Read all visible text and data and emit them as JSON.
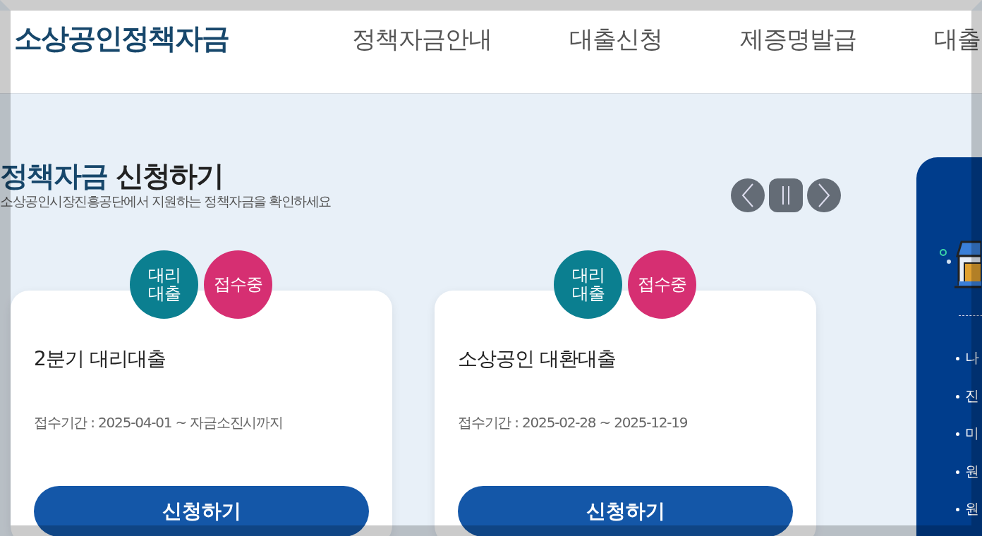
{
  "header": {
    "logo": "소상공인정책자금",
    "nav": [
      "정책자금안내",
      "대출신청",
      "제증명발급",
      "대출"
    ]
  },
  "section": {
    "title_highlight": "정책자금",
    "title_rest": "신청하기",
    "subtitle": "소상공인시장진흥공단에서 지원하는 정책자금을 확인하세요"
  },
  "carousel": {
    "paused": false
  },
  "cards": [
    {
      "badges": [
        {
          "text": "대리\n대출",
          "color": "#0b7f90"
        },
        {
          "text": "접수중",
          "color": "#d62f72"
        }
      ],
      "title": "2분기 대리대출",
      "period": "접수기간 : 2025-04-01 ~ 자금소진시까지",
      "button": "신청하기"
    },
    {
      "badges": [
        {
          "text": "대리\n대출",
          "color": "#0b7f90"
        },
        {
          "text": "접수중",
          "color": "#d62f72"
        }
      ],
      "title": "소상공인 대환대출",
      "period": "접수기간 : 2025-02-28 ~ 2025-12-19",
      "button": "신청하기"
    }
  ],
  "side_panel": {
    "items": [
      "나",
      "진",
      "미",
      "원",
      "원"
    ]
  }
}
